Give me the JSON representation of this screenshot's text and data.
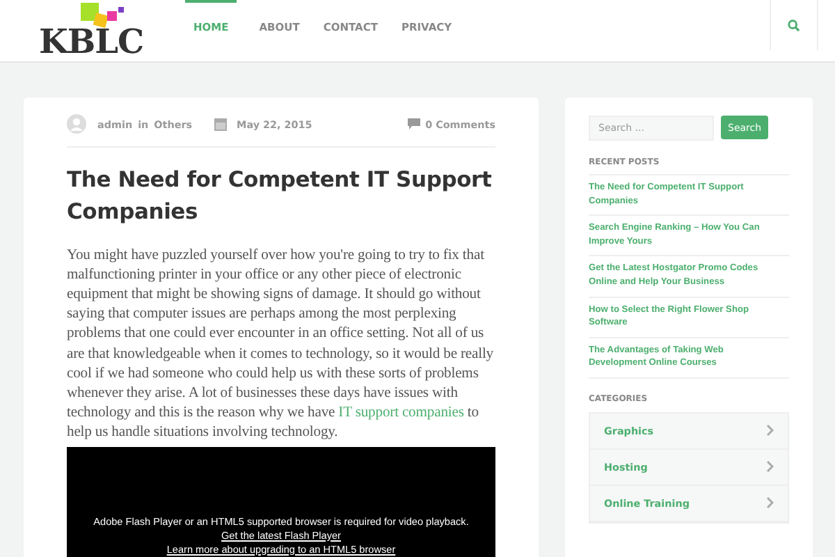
{
  "header": {
    "logo": "KBLC",
    "nav": [
      {
        "label": "HOME",
        "selected": true
      },
      {
        "label": "ABOUT",
        "selected": false
      },
      {
        "label": "CONTACT",
        "selected": false
      },
      {
        "label": "PRIVACY",
        "selected": false
      }
    ]
  },
  "post": {
    "author": "admin",
    "in_word": "in",
    "category": "Others",
    "date": "May 22, 2015",
    "comments": "0 Comments",
    "title": "The Need for Competent IT Support Companies",
    "body_before": "You might have puzzled yourself over how you're going to try to fix that malfunctioning printer in your office or any other piece of electronic equipment that might be showing signs of damage. It should go without saying that computer issues are perhaps among the most perplexing problems that one could ever encounter in an office setting. Not all of us are that knowledgeable when it comes to technology, so it would be really cool if we had someone who could help us with these sorts of problems whenever they arise. A lot of businesses these days have issues with technology and this is the reason why we have",
    "body_link": "IT support companies",
    "body_after": "to help us handle situations involving technology.",
    "video": {
      "message": "Adobe Flash Player or an HTML5 supported browser is required for video playback.",
      "links": [
        "Get the latest Flash Player",
        "Learn more about upgrading to an HTML5 browser"
      ]
    }
  },
  "sidebar": {
    "search": {
      "placeholder": "Search ...",
      "button": "Search"
    },
    "recent_posts": {
      "heading": "RECENT POSTS",
      "items": [
        "The Need for Competent IT Support Companies",
        "Search Engine Ranking – How You Can Improve Yours",
        "Get the Latest Hostgator Promo Codes Online and Help Your Business",
        "How to Select the Right Flower Shop Software",
        "The Advantages of Taking Web Development Online Courses"
      ]
    },
    "categories": {
      "heading": "CATEGORIES",
      "items": [
        "Graphics",
        "Hosting",
        "Online Training"
      ]
    }
  }
}
